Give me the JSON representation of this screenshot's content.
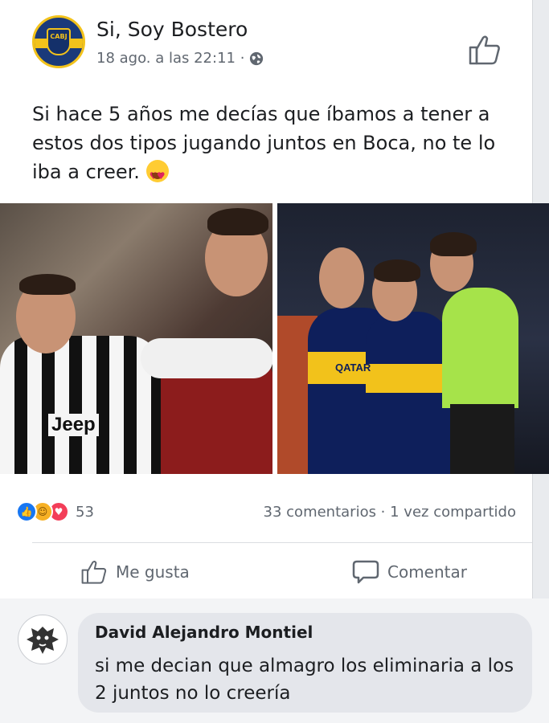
{
  "post": {
    "page_name": "Si, Soy Bostero",
    "avatar_text": "CABJ",
    "timestamp": "18 ago. a las 22:11 ·",
    "text": "Si hace 5 años me decías que íbamos a tener a estos dos tipos jugando juntos en Boca, no te lo iba a creer.",
    "photo_left_text": "Jeep",
    "photo_right_text": "QATAR"
  },
  "stats": {
    "reaction_count": "53",
    "comments_shares": "33 comentarios · 1 vez compartido"
  },
  "actions": {
    "like_label": "Me gusta",
    "comment_label": "Comentar"
  },
  "comment": {
    "author": "David Alejandro Montiel",
    "text": "si me decian que almagro los eliminaria a los 2 juntos no lo creería"
  },
  "colors": {
    "like_blue": "#1877f2",
    "haha_yellow": "#f7b125",
    "love_red": "#f33e58",
    "boca_blue": "#14306a",
    "boca_gold": "#f2c21b"
  },
  "icons": [
    "globe-icon",
    "like-outline-icon",
    "comment-icon",
    "like-reaction-icon",
    "haha-reaction-icon",
    "love-reaction-icon",
    "emoji-heart-eyes-icon"
  ]
}
